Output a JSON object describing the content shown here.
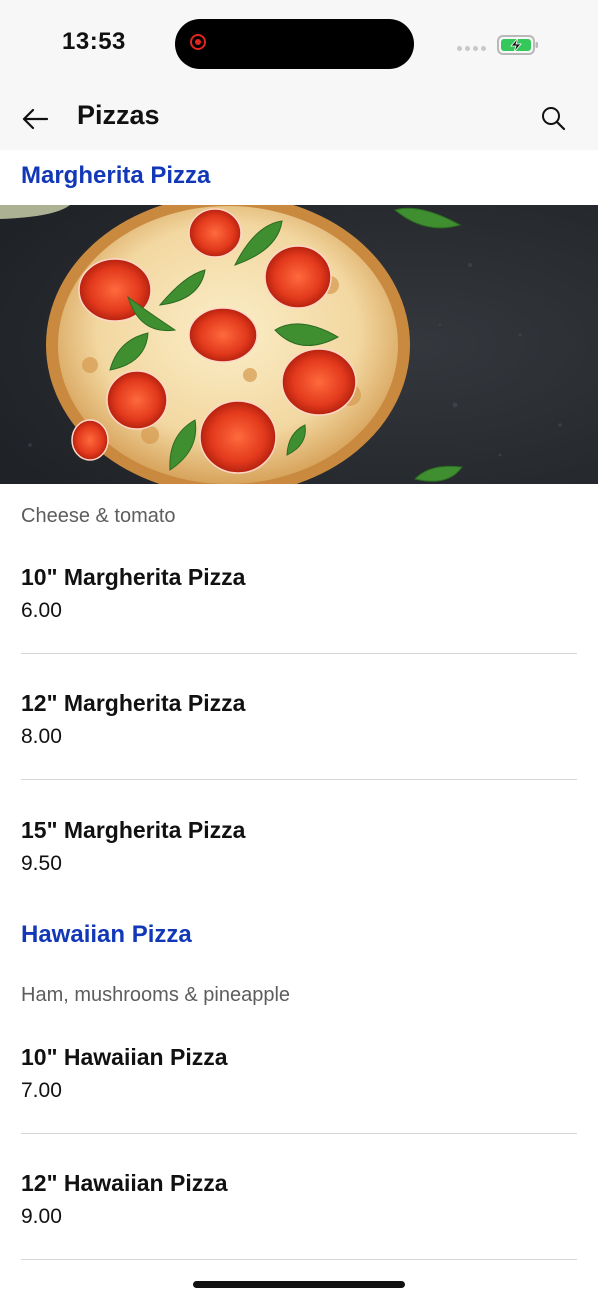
{
  "status_bar": {
    "time": "13:53"
  },
  "nav": {
    "title": "Pizzas",
    "back_icon": "arrow-left-icon",
    "search_icon": "search-icon"
  },
  "sections": [
    {
      "title": "Margherita Pizza",
      "description": "Cheese & tomato",
      "items": [
        {
          "name": "10\" Margherita Pizza",
          "price": "6.00"
        },
        {
          "name": "12\" Margherita Pizza",
          "price": "8.00"
        },
        {
          "name": "15\" Margherita Pizza",
          "price": "9.50"
        }
      ]
    },
    {
      "title": "Hawaiian Pizza",
      "description": "Ham, mushrooms & pineapple",
      "items": [
        {
          "name": "10\" Hawaiian Pizza",
          "price": "7.00"
        },
        {
          "name": "12\" Hawaiian Pizza",
          "price": "9.00"
        }
      ]
    }
  ],
  "colors": {
    "accent": "#1238b8",
    "text": "#111111",
    "muted": "#5d5d5d",
    "divider": "#d6d6d6",
    "recording": "#e0261f",
    "battery": "#34c759"
  }
}
